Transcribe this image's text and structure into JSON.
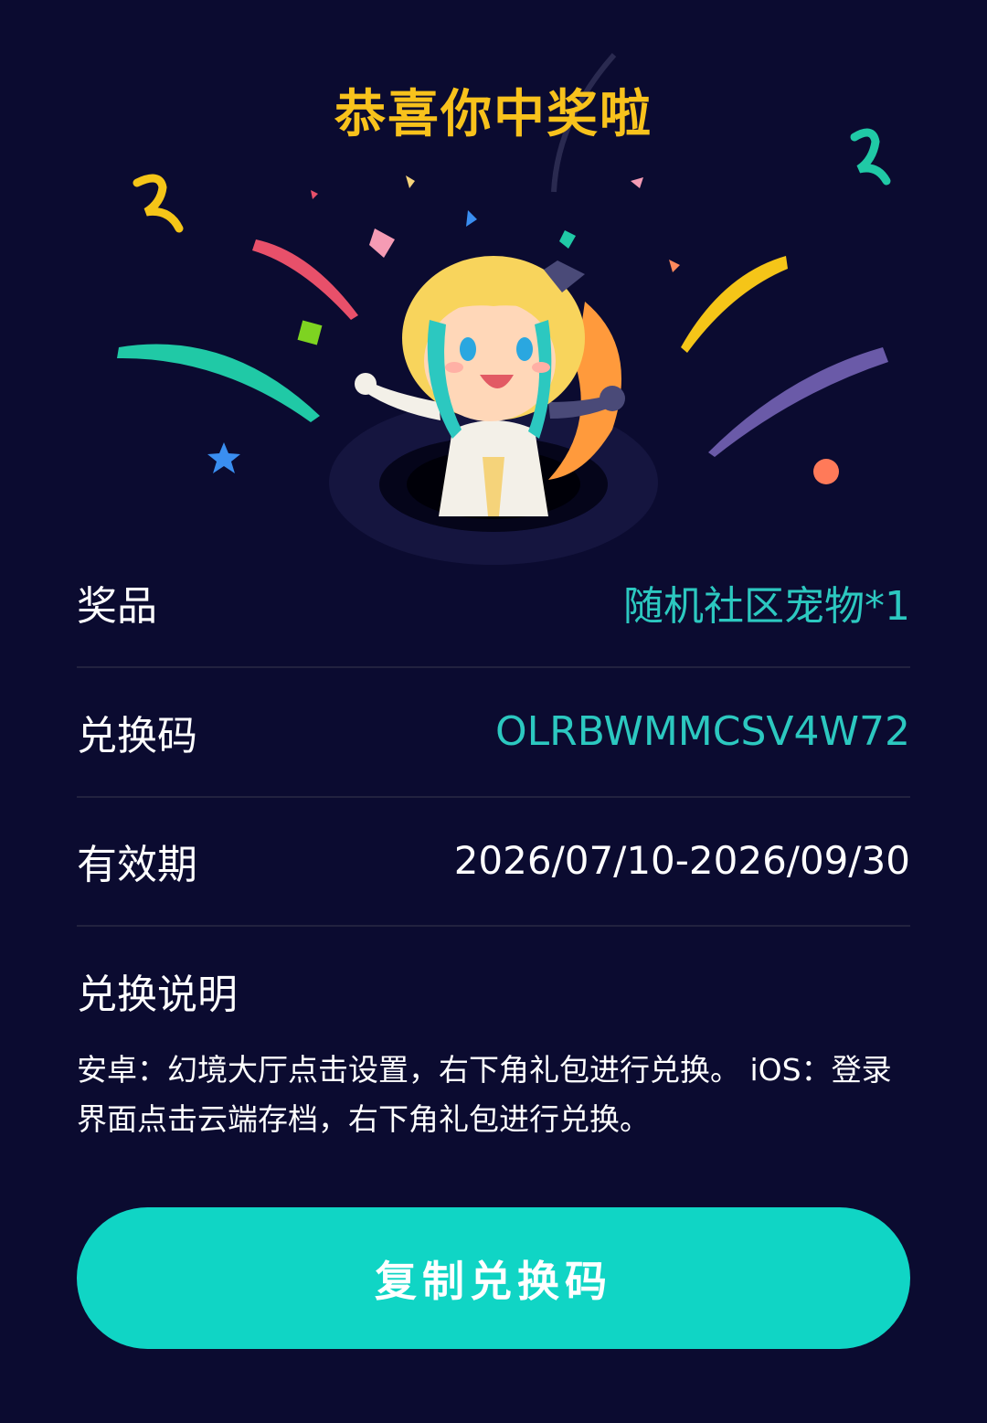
{
  "header": {
    "title": "恭喜你中奖啦"
  },
  "details": {
    "prize_label": "奖品",
    "prize_value": "随机社区宠物*1",
    "code_label": "兑换码",
    "code_value": "OLRBWMMCSV4W72",
    "validity_label": "有效期",
    "validity_value": "2026/07/10-2026/09/30"
  },
  "instructions": {
    "title": "兑换说明",
    "text": "安卓：幻境大厅点击设置，右下角礼包进行兑换。 iOS：登录界面点击云端存档，右下角礼包进行兑换。"
  },
  "actions": {
    "copy_label": "复制兑换码"
  },
  "colors": {
    "background": "#0b0b30",
    "title": "#f8c21c",
    "accent": "#2cc8c0",
    "button": "#10d5c5"
  }
}
